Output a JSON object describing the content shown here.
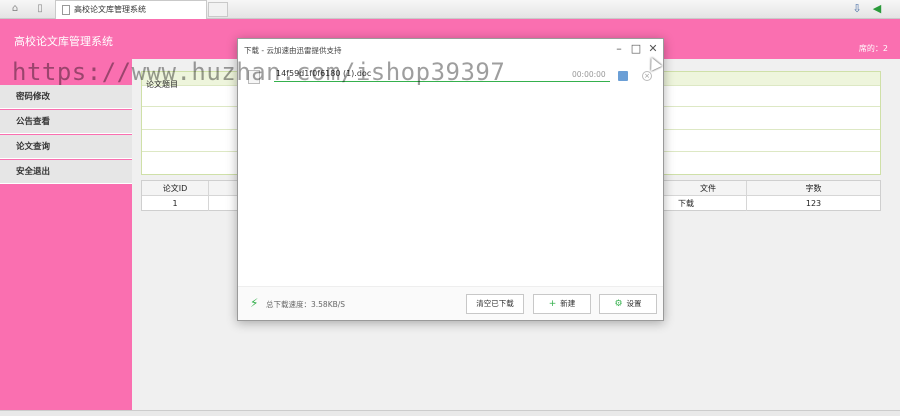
{
  "browser": {
    "tab_title": "高校论文库管理系统"
  },
  "app": {
    "title": "高校论文库管理系统",
    "user_label": "席的：2"
  },
  "sidebar": {
    "items": [
      {
        "label": "密码修改"
      },
      {
        "label": "公告查看"
      },
      {
        "label": "论文查询"
      },
      {
        "label": "安全退出"
      }
    ]
  },
  "form": {
    "label": "论文题目"
  },
  "table": {
    "columns": [
      "论文ID",
      "文件",
      "字数"
    ],
    "rows": [
      [
        "1",
        "下载",
        "123"
      ]
    ]
  },
  "download_dialog": {
    "title": "下载 - 云加速由迅雷提供支持",
    "file_name": "14f59d1f0f6180 (1).doc",
    "time": "00:00:00",
    "speed_label": "总下载速度：3.58KB/S",
    "btn_clear": "清空已下载",
    "btn_new": "新建",
    "btn_settings": "设置",
    "progress": 1.0
  },
  "watermark": "https://www.huzhan.com/ishop39397",
  "colors": {
    "brand_pink": "#fa6fb0",
    "progress_green": "#35b04d"
  }
}
